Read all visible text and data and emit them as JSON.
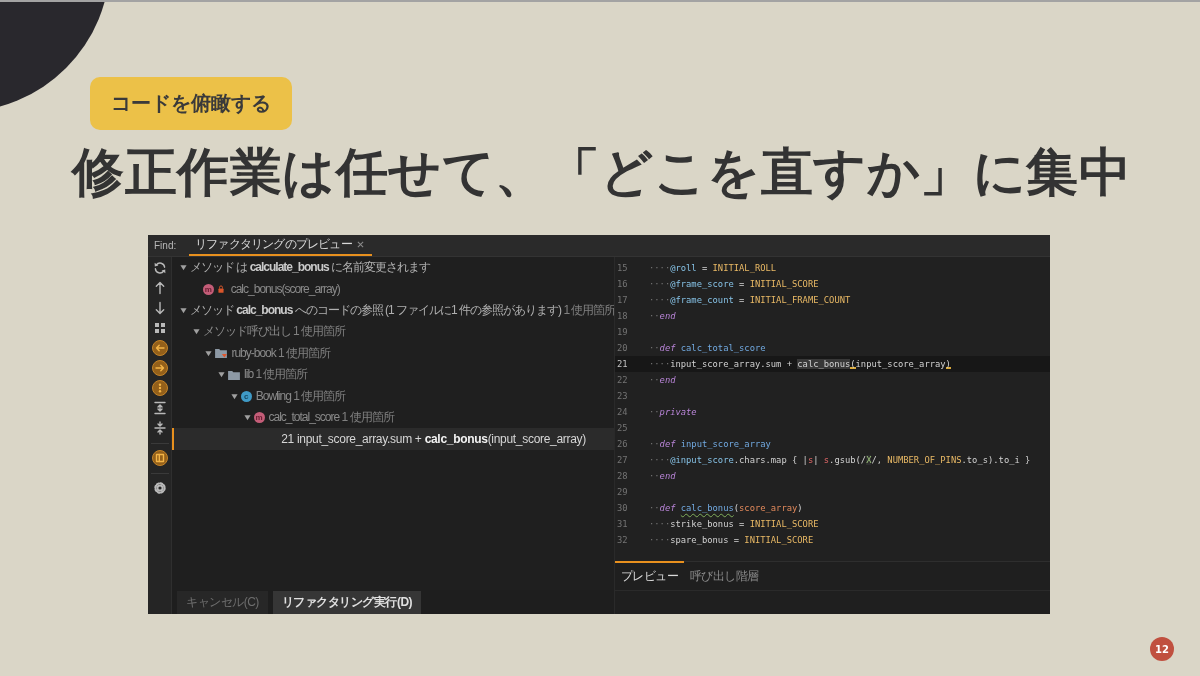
{
  "slide": {
    "section_badge": "コードを俯瞰する",
    "title": "修正作業は任せて、「どこを直すか」に集中",
    "page_number": "12"
  },
  "tool_window": {
    "header": {
      "find_label": "Find:",
      "tabs": [
        {
          "label": "リファクタリングのプレビュー",
          "selected": true
        }
      ]
    },
    "toolbar": [
      {
        "kind": "refresh",
        "on": false
      },
      {
        "kind": "up",
        "on": false
      },
      {
        "kind": "down",
        "on": false
      },
      {
        "kind": "group",
        "on": false
      },
      {
        "kind": "import",
        "on": true
      },
      {
        "kind": "export",
        "on": true
      },
      {
        "kind": "dots",
        "on": true
      },
      {
        "kind": "expand_all",
        "on": false
      },
      {
        "kind": "collapse_all",
        "on": false
      },
      {
        "kind": "separator"
      },
      {
        "kind": "panel",
        "on": true
      },
      {
        "kind": "separator"
      },
      {
        "kind": "settings",
        "on": false
      }
    ],
    "tree": [
      {
        "kind": "heading",
        "label": "メソッド は **calculate_bonus** に名前変更されます",
        "expanded": true,
        "selected": false,
        "children": [
          {
            "kind": "method",
            "badge": "m",
            "locked": true,
            "label": "calc_bonus(score_array)",
            "selected": false
          }
        ]
      },
      {
        "kind": "heading",
        "label": "メソッド **calc_bonus** へのコードの参照 (1 ファイルに1 件の参照があります)",
        "count": "1 使用箇所",
        "expanded": true,
        "selected": false,
        "children": [
          {
            "kind": "group",
            "label": "メソッド呼び出し",
            "count": "1 使用箇所",
            "expanded": true,
            "selected": false,
            "children": [
              {
                "kind": "project",
                "label": "ruby-book",
                "count": "1 使用箇所",
                "expanded": true,
                "selected": false,
                "children": [
                  {
                    "kind": "folder",
                    "label": "lib",
                    "count": "1 使用箇所",
                    "expanded": true,
                    "selected": false,
                    "children": [
                      {
                        "kind": "class",
                        "badge": "c",
                        "label": "Bowling",
                        "count": "1 使用箇所",
                        "expanded": true,
                        "selected": false,
                        "children": [
                          {
                            "kind": "method",
                            "badge": "m",
                            "label": "calc_total_score",
                            "count": "1 使用箇所",
                            "expanded": true,
                            "selected": false,
                            "children": [
                              {
                                "kind": "usage",
                                "label": "21 input_score_array.sum + **calc_bonus**(input_score_array)",
                                "selected": true
                              }
                            ]
                          }
                        ]
                      }
                    ]
                  }
                ]
              }
            ]
          }
        ]
      }
    ],
    "buttons": [
      {
        "label": "キャンセル(C)",
        "primary": false
      },
      {
        "label": "リファクタリング実行(D)",
        "primary": true
      }
    ],
    "editor": {
      "lines": [
        {
          "number": "15",
          "current": false,
          "tokens": [
            {
              "kind": "ws",
              "text": "····"
            },
            {
              "kind": "ivar",
              "text": "@roll"
            },
            {
              "kind": "plain",
              "text": " = "
            },
            {
              "kind": "const",
              "text": "INITIAL_ROLL"
            }
          ]
        },
        {
          "number": "16",
          "current": false,
          "tokens": [
            {
              "kind": "ws",
              "text": "····"
            },
            {
              "kind": "ivar",
              "text": "@frame_score"
            },
            {
              "kind": "plain",
              "text": " = "
            },
            {
              "kind": "const",
              "text": "INITIAL_SCORE"
            }
          ]
        },
        {
          "number": "17",
          "current": false,
          "tokens": [
            {
              "kind": "ws",
              "text": "····"
            },
            {
              "kind": "ivar",
              "text": "@frame_count"
            },
            {
              "kind": "plain",
              "text": " = "
            },
            {
              "kind": "const",
              "text": "INITIAL_FRAME_COUNT"
            }
          ]
        },
        {
          "number": "18",
          "current": false,
          "tokens": [
            {
              "kind": "ws",
              "text": "··"
            },
            {
              "kind": "keyword",
              "text": "end"
            }
          ]
        },
        {
          "number": "19",
          "current": false
        },
        {
          "number": "20",
          "current": false,
          "tokens": [
            {
              "kind": "ws",
              "text": "··"
            },
            {
              "kind": "keyword",
              "text": "def "
            },
            {
              "kind": "def_name",
              "text": "calc_total_score"
            }
          ]
        },
        {
          "number": "21",
          "current": true,
          "tokens": [
            {
              "kind": "ws",
              "text": "····"
            },
            {
              "kind": "plain",
              "text": "input_score_array.sum + "
            },
            {
              "kind": "usage",
              "text": "calc_bonus"
            },
            {
              "kind": "bracket",
              "text": "("
            },
            {
              "kind": "plain",
              "text": "input_score_array"
            },
            {
              "kind": "bracket",
              "text": ")"
            }
          ]
        },
        {
          "number": "22",
          "current": false,
          "tokens": [
            {
              "kind": "ws",
              "text": "··"
            },
            {
              "kind": "keyword",
              "text": "end"
            }
          ]
        },
        {
          "number": "23",
          "current": false
        },
        {
          "number": "24",
          "current": false,
          "tokens": [
            {
              "kind": "ws",
              "text": "··"
            },
            {
              "kind": "keyword",
              "text": "private"
            }
          ]
        },
        {
          "number": "25",
          "current": false
        },
        {
          "number": "26",
          "current": false,
          "tokens": [
            {
              "kind": "ws",
              "text": "··"
            },
            {
              "kind": "keyword",
              "text": "def "
            },
            {
              "kind": "def_name",
              "text": "input_score_array"
            }
          ]
        },
        {
          "number": "27",
          "current": false,
          "tokens": [
            {
              "kind": "ws",
              "text": "····"
            },
            {
              "kind": "ivar",
              "text": "@input_score"
            },
            {
              "kind": "plain",
              "text": ".chars.map { |"
            },
            {
              "kind": "local",
              "text": "s"
            },
            {
              "kind": "plain",
              "text": "| "
            },
            {
              "kind": "local",
              "text": "s"
            },
            {
              "kind": "plain",
              "text": ".gsub(/"
            },
            {
              "kind": "regex",
              "text": "X"
            },
            {
              "kind": "plain",
              "text": "/, "
            },
            {
              "kind": "const",
              "text": "NUMBER_OF_PINS"
            },
            {
              "kind": "plain",
              "text": ".to_s).to_i }"
            }
          ]
        },
        {
          "number": "28",
          "current": false,
          "tokens": [
            {
              "kind": "ws",
              "text": "··"
            },
            {
              "kind": "keyword",
              "text": "end"
            }
          ]
        },
        {
          "number": "29",
          "current": false
        },
        {
          "number": "30",
          "current": false,
          "tokens": [
            {
              "kind": "ws",
              "text": "··"
            },
            {
              "kind": "keyword",
              "text": "def "
            },
            {
              "kind": "def_name_warn",
              "text": "calc_bonus"
            },
            {
              "kind": "plain",
              "text": "("
            },
            {
              "kind": "param",
              "text": "score_array"
            },
            {
              "kind": "plain",
              "text": ")"
            }
          ]
        },
        {
          "number": "31",
          "current": false,
          "tokens": [
            {
              "kind": "ws",
              "text": "····"
            },
            {
              "kind": "plain",
              "text": "strike_bonus = "
            },
            {
              "kind": "const",
              "text": "INITIAL_SCORE"
            }
          ]
        },
        {
          "number": "32",
          "current": false,
          "tokens": [
            {
              "kind": "ws",
              "text": "····"
            },
            {
              "kind": "plain",
              "text": "spare_bonus = "
            },
            {
              "kind": "const",
              "text": "INITIAL_SCORE"
            }
          ]
        }
      ]
    },
    "editor_tabs": [
      {
        "label": "プレビュー",
        "selected": true
      },
      {
        "label": "呼び出し階層",
        "selected": false
      }
    ]
  }
}
